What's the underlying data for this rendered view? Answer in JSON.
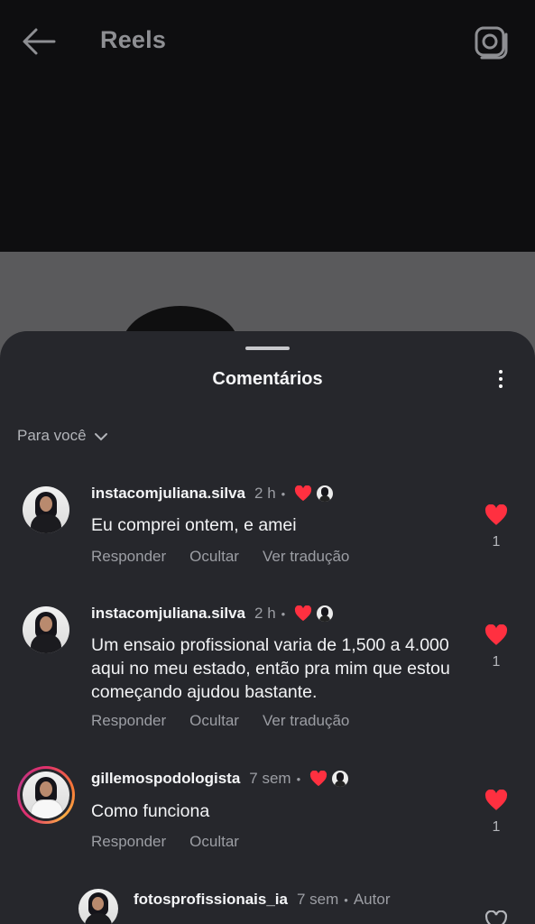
{
  "header": {
    "title": "Reels",
    "back_icon": "arrow-left-icon",
    "camera_icon": "camera-icon"
  },
  "sheet": {
    "title": "Comentários",
    "more_icon": "more-vertical-icon"
  },
  "filter": {
    "label": "Para você"
  },
  "colors": {
    "heart": "#ff3040",
    "sheet_bg": "#26272c",
    "muted": "#9c9ea4"
  },
  "comments": [
    {
      "username": "instacomjuliana.silva",
      "time": "2 h",
      "text": "Eu comprei ontem, e amei",
      "actions": [
        "Responder",
        "Ocultar",
        "Ver tradução"
      ],
      "likes": "1"
    },
    {
      "username": "instacomjuliana.silva",
      "time": "2 h",
      "text": "Um ensaio profissional varia de 1,500 a 4.000 aqui no meu estado, então pra mim que estou começando ajudou bastante.",
      "actions": [
        "Responder",
        "Ocultar",
        "Ver tradução"
      ],
      "likes": "1"
    },
    {
      "username": "gillemospodologista",
      "time": "7 sem",
      "text": "Como funciona",
      "actions": [
        "Responder",
        "Ocultar"
      ],
      "likes": "1"
    },
    {
      "username": "fotosprofissionais_ia",
      "time": "7 sem",
      "author_label": "Autor"
    }
  ]
}
